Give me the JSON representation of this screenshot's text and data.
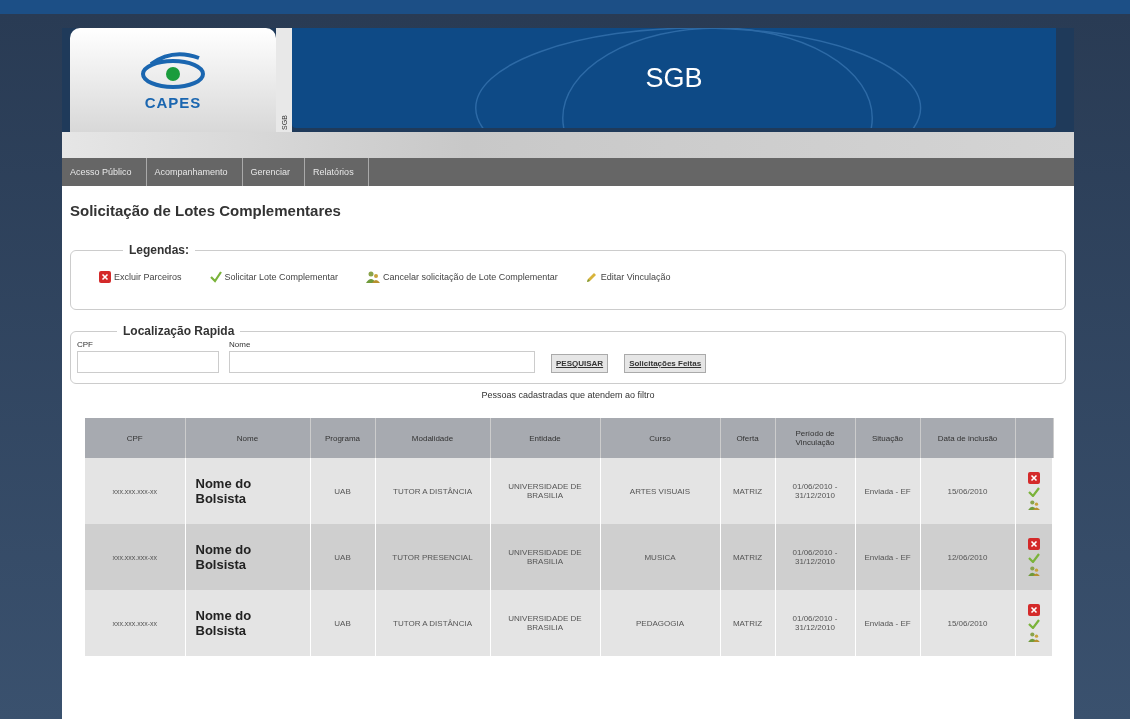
{
  "header": {
    "logo_text": "CAPES",
    "banner_title": "SGB",
    "side_label": "SGB"
  },
  "menu": [
    {
      "label": "Acesso Público"
    },
    {
      "label": "Acompanhamento"
    },
    {
      "label": "Gerenciar"
    },
    {
      "label": "Relatórios"
    }
  ],
  "page_title": "Solicitação de Lotes Complementares",
  "legend": {
    "title": "Legendas:",
    "items": [
      {
        "kind": "delete",
        "label": "Excluir Parceiros"
      },
      {
        "kind": "request",
        "label": "Solicitar Lote Complementar"
      },
      {
        "kind": "cancel",
        "label": "Cancelar solicitação de Lote Complementar"
      },
      {
        "kind": "edit",
        "label": "Editar Vinculação"
      }
    ]
  },
  "search": {
    "title": "Localização Rapida",
    "cpf_label": "CPF",
    "name_label": "Nome",
    "buttons": [
      "PESQUISAR",
      "Solicitações Feitas"
    ]
  },
  "table": {
    "caption": "Pessoas cadastradas que atendem ao filtro",
    "columns": [
      "CPF",
      "Nome",
      "Programa",
      "Modalidade",
      "Entidade",
      "Curso",
      "Oferta",
      "Período de Vinculação",
      "Situação",
      "Data de inclusão"
    ],
    "rows": [
      {
        "cells": [
          "xxx.xxx.xxx-xx",
          "Nome do Bolsista",
          "UAB",
          "TUTOR A DISTÂNCIA",
          "UNIVERSIDADE DE BRASILIA",
          "ARTES VISUAIS",
          "MATRIZ",
          "01/06/2010 - 31/12/2010",
          "Enviada - EF",
          "15/06/2010"
        ]
      },
      {
        "cells": [
          "xxx.xxx.xxx-xx",
          "Nome do Bolsista",
          "UAB",
          "TUTOR PRESENCIAL",
          "UNIVERSIDADE DE BRASILIA",
          "MUSICA",
          "MATRIZ",
          "01/06/2010 - 31/12/2010",
          "Enviada - EF",
          "12/06/2010"
        ]
      },
      {
        "cells": [
          "xxx.xxx.xxx-xx",
          "Nome do Bolsista",
          "UAB",
          "TUTOR A DISTÂNCIA",
          "UNIVERSIDADE DE BRASILIA",
          "PEDAGOGIA",
          "MATRIZ",
          "01/06/2010 - 31/12/2010",
          "Enviada - EF",
          "15/06/2010"
        ]
      }
    ]
  }
}
